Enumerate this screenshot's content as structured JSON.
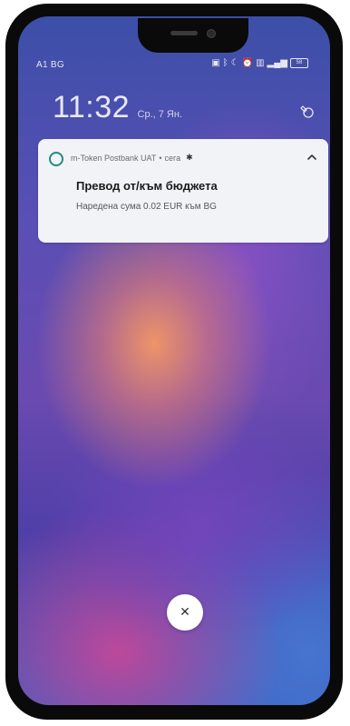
{
  "status_bar": {
    "carrier": "A1 BG",
    "icons": [
      "nfc-icon",
      "bluetooth-icon",
      "moon-icon",
      "alarm-icon",
      "vibrate-icon",
      "signal-icon",
      "battery-icon"
    ],
    "battery_label": "58"
  },
  "lock_screen": {
    "time": "11:32",
    "date": "Ср., 7 Ян.",
    "edit_icon": "edit-theme-icon"
  },
  "notification": {
    "app_name": "m-Token Postbank UAT",
    "separator": " • ",
    "time_ago": "сега",
    "title": "Превод от/към бюджета",
    "body": "Наредена сума 0.02 EUR към BG",
    "collapse_glyph": "^",
    "accent_color": "#1f8c86"
  },
  "dismiss": {
    "glyph": "✕"
  }
}
